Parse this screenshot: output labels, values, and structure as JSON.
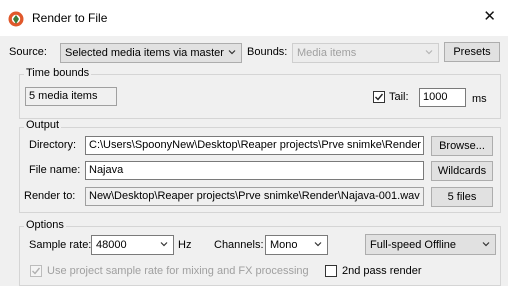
{
  "window": {
    "title": "Render to File",
    "close_glyph": "✕"
  },
  "source": {
    "label": "Source:",
    "value": "Selected media items via master"
  },
  "bounds": {
    "label": "Bounds:",
    "value": "Media items"
  },
  "buttons": {
    "presets": "Presets",
    "browse": "Browse...",
    "wildcards": "Wildcards",
    "files": "5 files"
  },
  "time_bounds": {
    "group_label": "Time bounds",
    "items_text": "5 media items",
    "tail_label": "Tail:",
    "tail_checked": true,
    "tail_value": "1000",
    "tail_unit": "ms"
  },
  "output": {
    "group_label": "Output",
    "directory_label": "Directory:",
    "directory_value": "C:\\Users\\SpoonyNew\\Desktop\\Reaper projects\\Prve snimke\\Render",
    "filename_label": "File name:",
    "filename_value": "Najava",
    "renderto_label": "Render to:",
    "renderto_value": "New\\Desktop\\Reaper projects\\Prve snimke\\Render\\Najava-001.wav"
  },
  "options": {
    "group_label": "Options",
    "samplerate_label": "Sample rate:",
    "samplerate_value": "48000",
    "samplerate_unit": "Hz",
    "channels_label": "Channels:",
    "channels_value": "Mono",
    "mode_value": "Full-speed Offline",
    "project_rate_label": "Use project sample rate for mixing and FX processing",
    "project_rate_checked": true,
    "second_pass_label": "2nd pass render",
    "second_pass_checked": false
  },
  "colors": {
    "accent": "#e0582b",
    "window_bg": "#f0f0f0",
    "titlebar_bg": "#ffffff"
  }
}
